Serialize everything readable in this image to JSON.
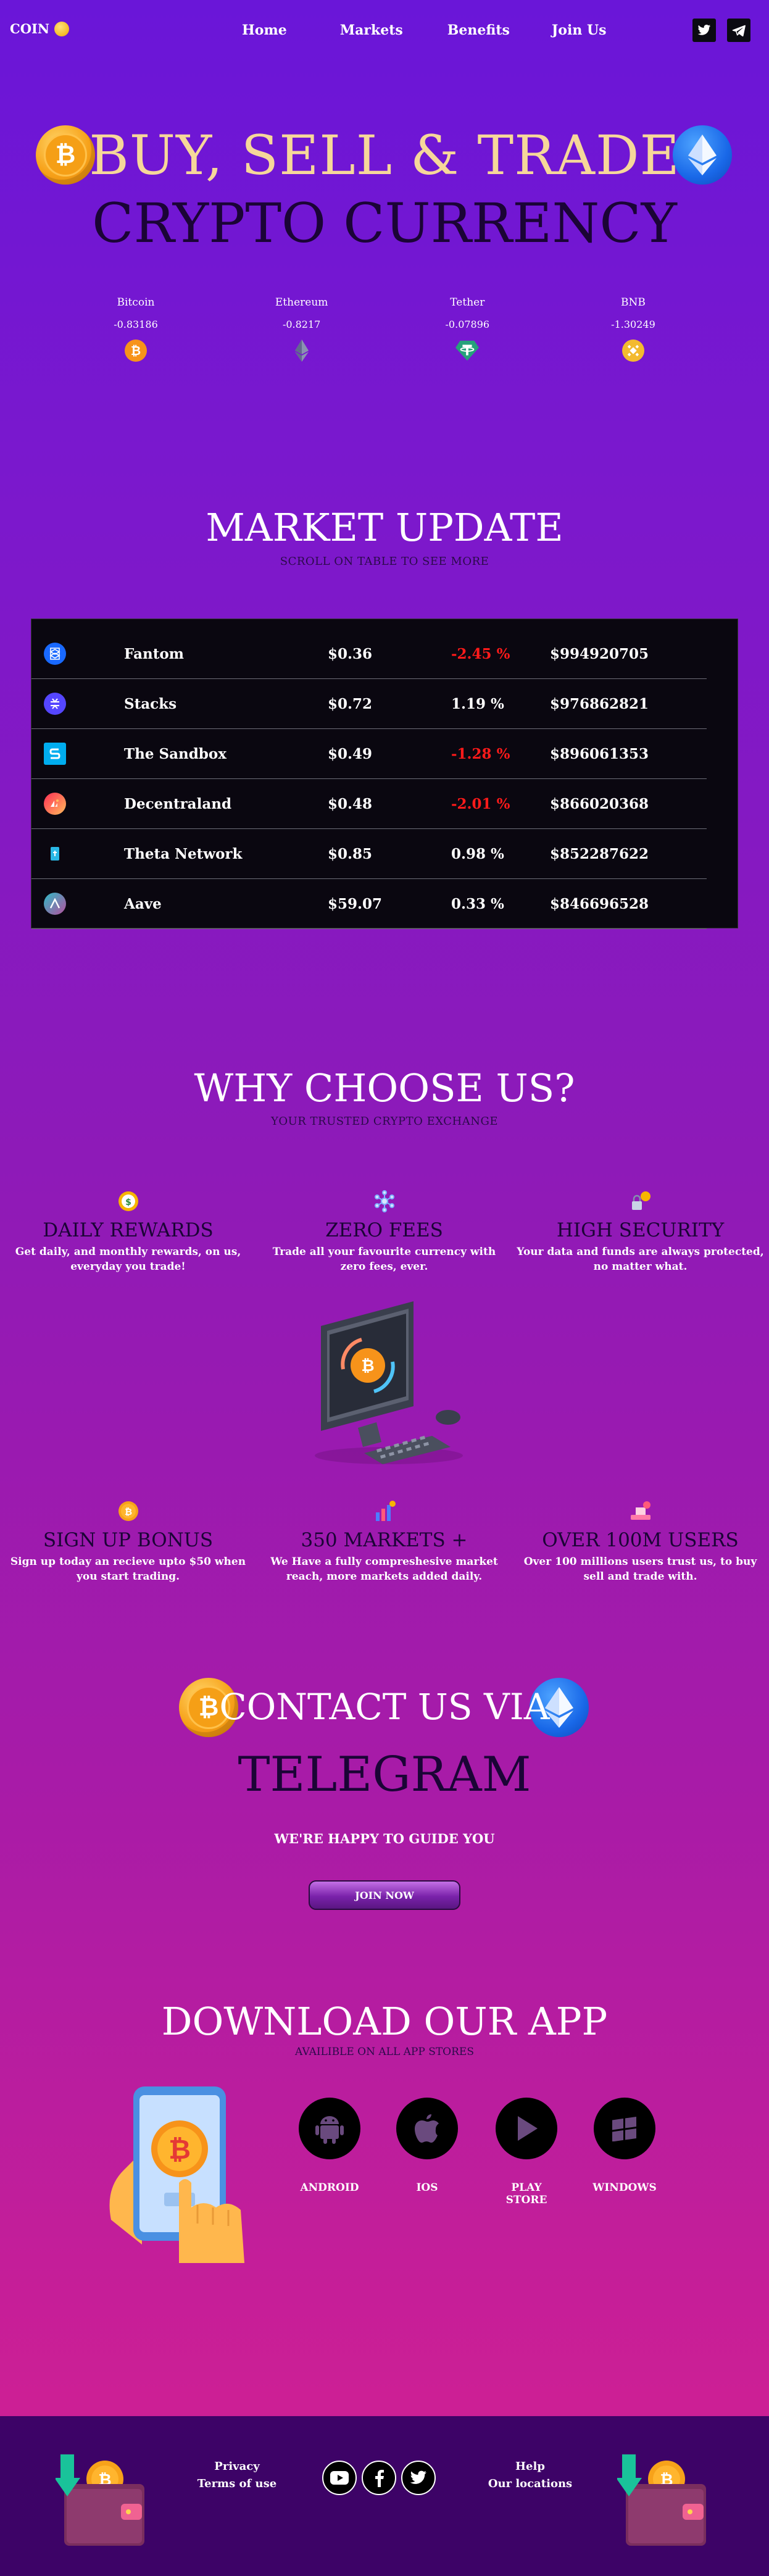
{
  "nav": {
    "logo_text": "COIN",
    "links": [
      "Home",
      "Markets",
      "Benefits",
      "Join Us"
    ]
  },
  "hero": {
    "title_line1": "BUY, SELL & TRADE",
    "title_line2": "CRYPTO CURRENCY"
  },
  "ticker": [
    {
      "name": "Bitcoin",
      "change": "-0.83186",
      "icon": "bitcoin-icon"
    },
    {
      "name": "Ethereum",
      "change": "-0.8217",
      "icon": "ethereum-icon"
    },
    {
      "name": "Tether",
      "change": "-0.07896",
      "icon": "tether-icon"
    },
    {
      "name": "BNB",
      "change": "-1.30249",
      "icon": "bnb-icon"
    }
  ],
  "market": {
    "title": "MARKET UPDATE",
    "subtitle": "SCROLL ON TABLE TO SEE MORE",
    "rows": [
      {
        "name": "Fantom",
        "price": "$0.36",
        "change": "-2.45 %",
        "cap": "$994920705",
        "icon": "fantom-icon",
        "color": "#1969ff"
      },
      {
        "name": "Stacks",
        "price": "$0.72",
        "change": "1.19 %",
        "cap": "$976862821",
        "icon": "stacks-icon",
        "color": "#5546ff"
      },
      {
        "name": "The Sandbox",
        "price": "$0.49",
        "change": "-1.28 %",
        "cap": "$896061353",
        "icon": "sandbox-icon",
        "color": "#00adef"
      },
      {
        "name": "Decentraland",
        "price": "$0.48",
        "change": "-2.01 %",
        "cap": "$866020368",
        "icon": "decentraland-icon",
        "color": "#ff2d55"
      },
      {
        "name": "Theta Network",
        "price": "$0.85",
        "change": "0.98 %",
        "cap": "$852287622",
        "icon": "theta-icon",
        "color": "#2ab8e6"
      },
      {
        "name": "Aave",
        "price": "$59.07",
        "change": "0.33 %",
        "cap": "$846696528",
        "icon": "aave-icon",
        "color": "#b6509e"
      }
    ]
  },
  "why": {
    "title": "WHY CHOOSE US?",
    "subtitle": "YOUR TRUSTED CRYPTO EXCHANGE",
    "features": [
      {
        "title": "DAILY REWARDS",
        "desc": "Get daily, and monthly rewards, on us, everyday you trade!",
        "icon": "rewards-icon"
      },
      {
        "title": "ZERO FEES",
        "desc": "Trade all your favourite currency with zero fees, ever.",
        "icon": "network-icon"
      },
      {
        "title": "HIGH SECURITY",
        "desc": "Your data and funds are always protected, no matter what.",
        "icon": "security-icon"
      },
      {
        "title": "SIGN UP BONUS",
        "desc": "Sign up today an recieve upto $50 when you start trading.",
        "icon": "bonus-coin-icon"
      },
      {
        "title": "350 MARKETS +",
        "desc": "We Have a fully compreshesive market reach, more markets added daily.",
        "icon": "chart-icon"
      },
      {
        "title": "OVER 100M USERS",
        "desc": "Over 100 millions users trust us, to buy sell and trade with.",
        "icon": "users-icon"
      }
    ]
  },
  "contact": {
    "title_line1": "CONTACT US VIA",
    "title_line2": "TELEGRAM",
    "subtitle": "WE'RE HAPPY TO GUIDE YOU",
    "button": "JOIN NOW"
  },
  "app": {
    "title": "DOWNLOAD OUR APP",
    "subtitle": "AVAILIBLE ON ALL APP STORES",
    "stores": [
      {
        "label": "ANDROID",
        "icon": "android-icon"
      },
      {
        "label": "IOS",
        "icon": "apple-icon"
      },
      {
        "label": "PLAY STORE",
        "icon": "play-store-icon"
      },
      {
        "label": "WINDOWS",
        "icon": "windows-icon"
      }
    ]
  },
  "footer": {
    "privacy": "Privacy",
    "terms": "Terms of use",
    "help": "Help",
    "locations": "Our locations"
  }
}
